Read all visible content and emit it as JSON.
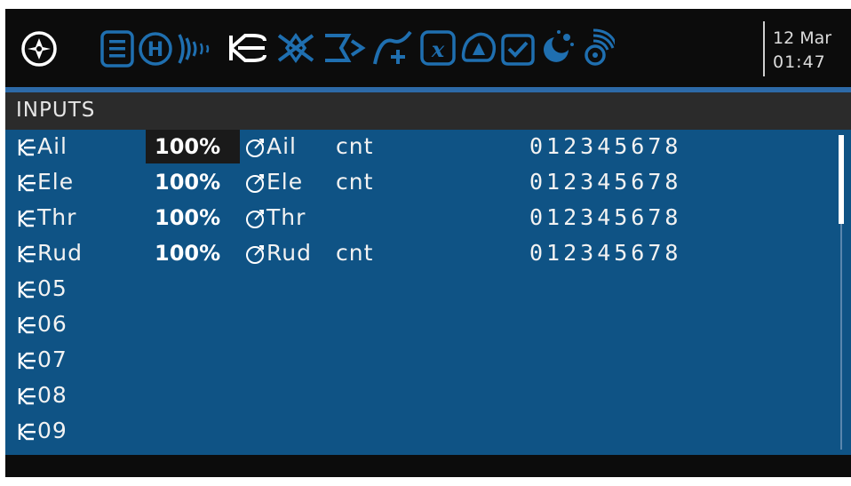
{
  "header": {
    "icons": [
      {
        "name": "radio-menu-icon"
      },
      {
        "name": "model-setup-icon"
      },
      {
        "name": "heli-setup-icon"
      },
      {
        "name": "flight-modes-icon"
      },
      {
        "name": "inputs-icon",
        "active": true
      },
      {
        "name": "mixer-icon"
      },
      {
        "name": "outputs-icon"
      },
      {
        "name": "curves-icon"
      },
      {
        "name": "global-variables-icon"
      },
      {
        "name": "logical-switches-icon"
      },
      {
        "name": "special-functions-icon"
      },
      {
        "name": "lua-scripts-icon"
      },
      {
        "name": "telemetry-icon"
      }
    ],
    "date": "12 Mar",
    "time": "01:47"
  },
  "page": {
    "title": "INPUTS"
  },
  "inputs": [
    {
      "name": "Ail",
      "weight": "100%",
      "source": "Ail",
      "modifier": "cnt",
      "flight_modes": "012345678",
      "selected": true
    },
    {
      "name": "Ele",
      "weight": "100%",
      "source": "Ele",
      "modifier": "cnt",
      "flight_modes": "012345678"
    },
    {
      "name": "Thr",
      "weight": "100%",
      "source": "Thr",
      "modifier": "",
      "flight_modes": "012345678"
    },
    {
      "name": "Rud",
      "weight": "100%",
      "source": "Rud",
      "modifier": "cnt",
      "flight_modes": "012345678"
    },
    {
      "name": "05"
    },
    {
      "name": "06"
    },
    {
      "name": "07"
    },
    {
      "name": "08"
    },
    {
      "name": "09"
    }
  ],
  "colors": {
    "background": "#0c0c0c",
    "list_background": "#0f5385",
    "title_bar": "#2b2b2b",
    "accent_line": "#2d6aa8",
    "active_icon": "#ffffff",
    "inactive_icon": "#1f6fb0"
  }
}
